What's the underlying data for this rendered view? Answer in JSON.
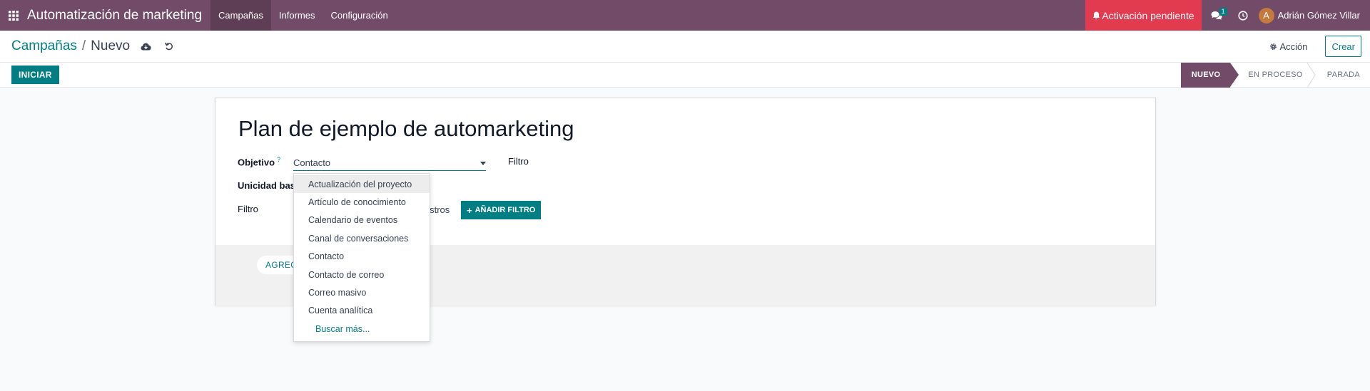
{
  "navbar": {
    "app_name": "Automatización de marketing",
    "menu": [
      "Campañas",
      "Informes",
      "Configuración"
    ],
    "activation": "Activación pendiente",
    "messages_count": "1",
    "user": {
      "initial": "A",
      "name": "Adrián Gómez Villar"
    }
  },
  "control": {
    "breadcrumb_parent": "Campañas",
    "breadcrumb_sep": "/",
    "breadcrumb_current": "Nuevo",
    "action_label": "Acción",
    "create_label": "Crear"
  },
  "statusbar": {
    "start_label": "INICIAR",
    "stages": [
      "NUEVO",
      "EN PROCESO",
      "PARADA"
    ],
    "current_stage": "NUEVO"
  },
  "form": {
    "title": "Plan de ejemplo de automarketing",
    "objective_label": "Objetivo",
    "help_mark": "?",
    "objective_value": "Contacto",
    "filter_right_label": "Filtro",
    "uniqueness_label": "Unicidad bas",
    "filter_label": "Filtro",
    "records_text": "gistros",
    "add_filter_label": "AÑADIR FILTRO",
    "add_activity_label": "AGREG"
  },
  "dropdown": {
    "items": [
      "Actualización del proyecto",
      "Artículo de conocimiento",
      "Calendario de eventos",
      "Canal de conversaciones",
      "Contacto",
      "Contacto de correo",
      "Correo masivo",
      "Cuenta analítica"
    ],
    "more_label": "Buscar más..."
  },
  "colors": {
    "brand": "#714b67",
    "accent": "#017e84",
    "danger": "#e23a4f"
  }
}
